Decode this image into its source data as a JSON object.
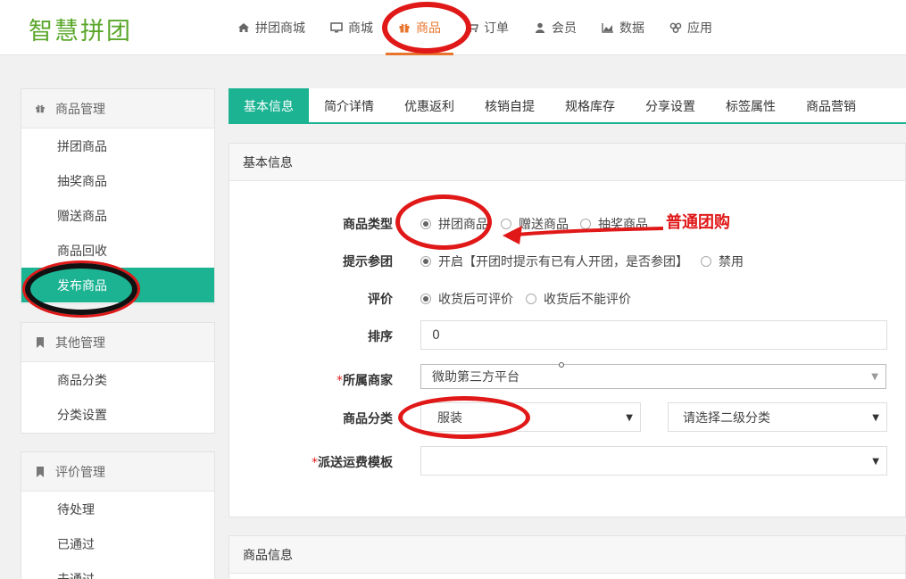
{
  "header": {
    "logo": "智慧拼团",
    "nav": [
      {
        "label": "拼团商城",
        "icon": "home-icon"
      },
      {
        "label": "商城",
        "icon": "monitor-icon"
      },
      {
        "label": "商品",
        "icon": "gift-icon"
      },
      {
        "label": "订单",
        "icon": "cart-icon"
      },
      {
        "label": "会员",
        "icon": "user-icon"
      },
      {
        "label": "数据",
        "icon": "chart-icon"
      },
      {
        "label": "应用",
        "icon": "apps-icon"
      }
    ],
    "active_nav": "商品"
  },
  "sidebar": {
    "groups": [
      {
        "title": "商品管理",
        "icon": "gift-icon",
        "items": [
          "拼团商品",
          "抽奖商品",
          "赠送商品",
          "商品回收",
          "发布商品"
        ],
        "active": "发布商品"
      },
      {
        "title": "其他管理",
        "icon": "bookmark-icon",
        "items": [
          "商品分类",
          "分类设置"
        ]
      },
      {
        "title": "评价管理",
        "icon": "bookmark-icon",
        "items": [
          "待处理",
          "已通过",
          "未通过"
        ]
      }
    ]
  },
  "tabs": [
    "基本信息",
    "简介详情",
    "优惠返利",
    "核销自提",
    "规格库存",
    "分享设置",
    "标签属性",
    "商品营销"
  ],
  "active_tab": "基本信息",
  "basic_card": {
    "title": "基本信息",
    "fields": {
      "type": {
        "label": "商品类型",
        "options": [
          "拼团商品",
          "赠送商品",
          "抽奖商品"
        ],
        "selected": "拼团商品"
      },
      "hint": {
        "label": "提示参团",
        "options": [
          "开启【开团时提示有已有人开团，是否参团】",
          "禁用"
        ],
        "selected": "开启【开团时提示有已有人开团，是否参团】"
      },
      "review": {
        "label": "评价",
        "options": [
          "收货后可评价",
          "收货后不能评价"
        ],
        "selected": "收货后可评价"
      },
      "sort": {
        "label": "排序",
        "value": "0"
      },
      "merchant": {
        "label": "所属商家",
        "required": "*",
        "value": "微助第三方平台"
      },
      "category": {
        "label": "商品分类",
        "value": "服装",
        "second_placeholder": "请选择二级分类"
      },
      "shipping": {
        "label": "派送运费模板",
        "required": "*",
        "value": ""
      }
    }
  },
  "info_card": {
    "title": "商品信息"
  },
  "annotation": {
    "text": "普通团购",
    "color": "#e01818"
  }
}
